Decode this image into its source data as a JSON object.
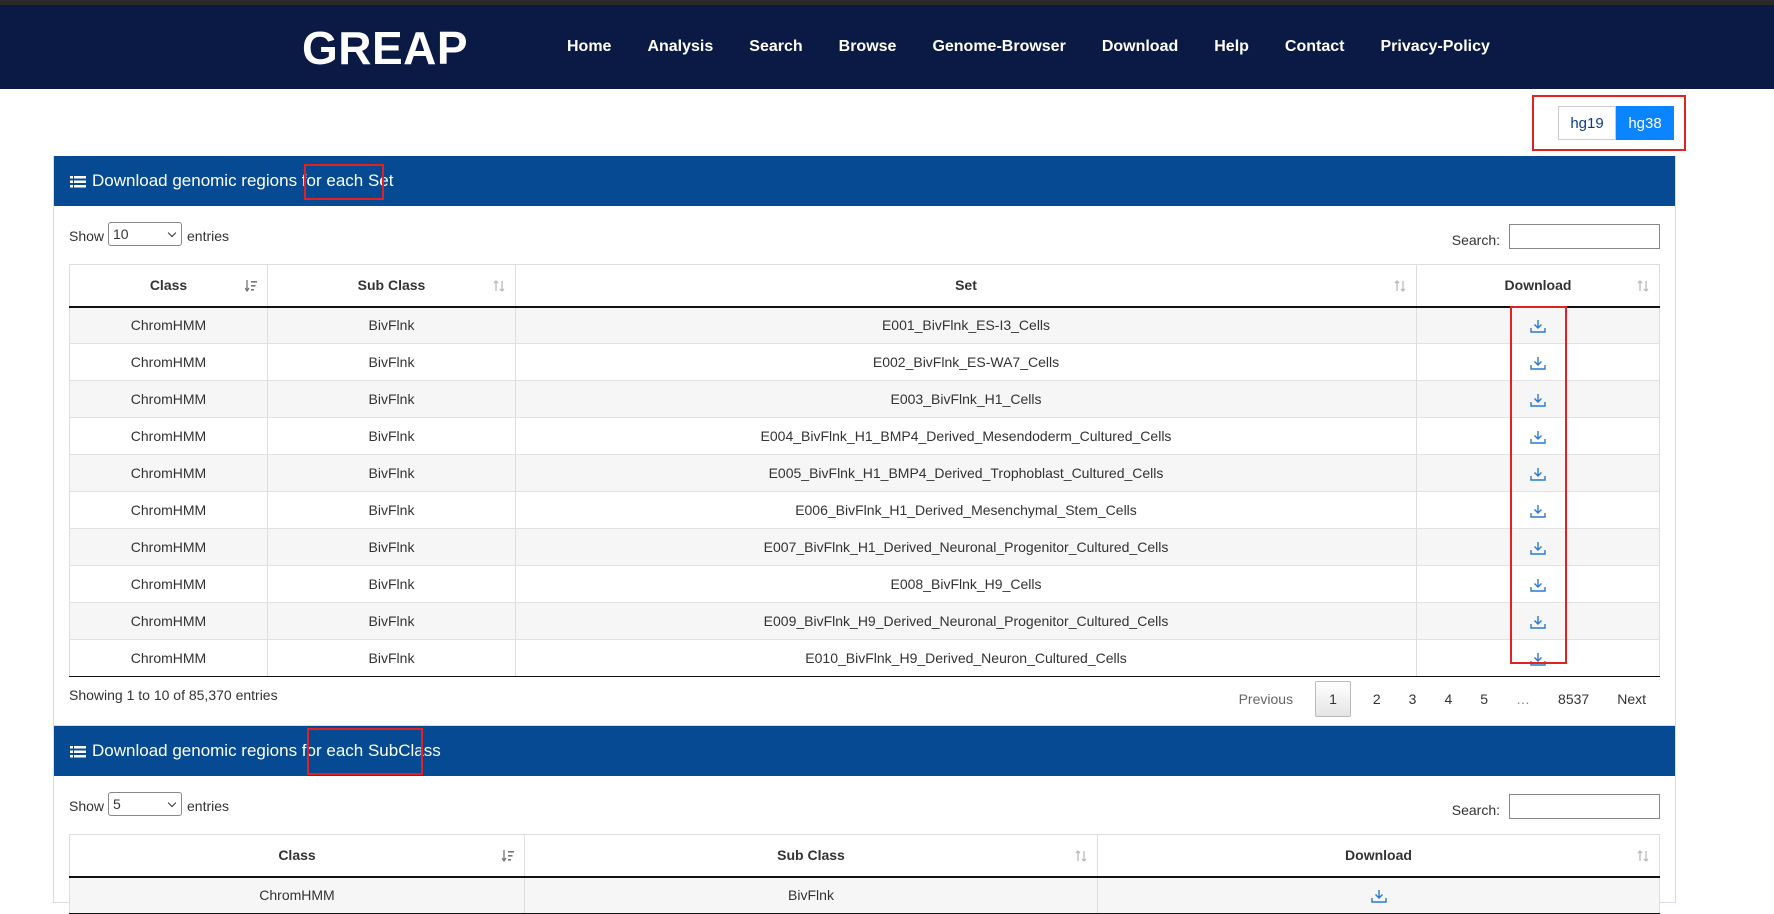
{
  "brand": "GREAP",
  "nav": [
    "Home",
    "Analysis",
    "Search",
    "Browse",
    "Genome-Browser",
    "Download",
    "Help",
    "Contact",
    "Privacy-Policy"
  ],
  "genome": {
    "options": [
      "hg19",
      "hg38"
    ],
    "selected": "hg38"
  },
  "colors": {
    "navbar": "#0b1a45",
    "panel_header": "#054a93",
    "active": "#0a84ff",
    "highlight": "#e32121"
  },
  "set_panel": {
    "title_prefix": "Download genomic regions for",
    "title_highlight": "each Set",
    "show_label": "Show",
    "page_size": "10",
    "entries_label": "entries",
    "search_label": "Search:",
    "columns": [
      "Class",
      "Sub Class",
      "Set",
      "Download"
    ],
    "rows": [
      {
        "class": "ChromHMM",
        "subclass": "BivFlnk",
        "set": "E001_BivFlnk_ES-I3_Cells"
      },
      {
        "class": "ChromHMM",
        "subclass": "BivFlnk",
        "set": "E002_BivFlnk_ES-WA7_Cells"
      },
      {
        "class": "ChromHMM",
        "subclass": "BivFlnk",
        "set": "E003_BivFlnk_H1_Cells"
      },
      {
        "class": "ChromHMM",
        "subclass": "BivFlnk",
        "set": "E004_BivFlnk_H1_BMP4_Derived_Mesendoderm_Cultured_Cells"
      },
      {
        "class": "ChromHMM",
        "subclass": "BivFlnk",
        "set": "E005_BivFlnk_H1_BMP4_Derived_Trophoblast_Cultured_Cells"
      },
      {
        "class": "ChromHMM",
        "subclass": "BivFlnk",
        "set": "E006_BivFlnk_H1_Derived_Mesenchymal_Stem_Cells"
      },
      {
        "class": "ChromHMM",
        "subclass": "BivFlnk",
        "set": "E007_BivFlnk_H1_Derived_Neuronal_Progenitor_Cultured_Cells"
      },
      {
        "class": "ChromHMM",
        "subclass": "BivFlnk",
        "set": "E008_BivFlnk_H9_Cells"
      },
      {
        "class": "ChromHMM",
        "subclass": "BivFlnk",
        "set": "E009_BivFlnk_H9_Derived_Neuronal_Progenitor_Cultured_Cells"
      },
      {
        "class": "ChromHMM",
        "subclass": "BivFlnk",
        "set": "E010_BivFlnk_H9_Derived_Neuron_Cultured_Cells"
      }
    ],
    "info": "Showing 1 to 10 of 85,370 entries",
    "pagination": {
      "previous": "Previous",
      "pages": [
        "1",
        "2",
        "3",
        "4",
        "5"
      ],
      "ellipsis": "…",
      "last": "8537",
      "next": "Next",
      "current": "1"
    }
  },
  "subclass_panel": {
    "title_prefix": "Download genomic regions for",
    "title_highlight": "each SubClass",
    "show_label": "Show",
    "page_size": "5",
    "entries_label": "entries",
    "search_label": "Search:",
    "columns": [
      "Class",
      "Sub Class",
      "Download"
    ],
    "rows": [
      {
        "class": "ChromHMM",
        "subclass": "BivFlnk"
      }
    ]
  }
}
